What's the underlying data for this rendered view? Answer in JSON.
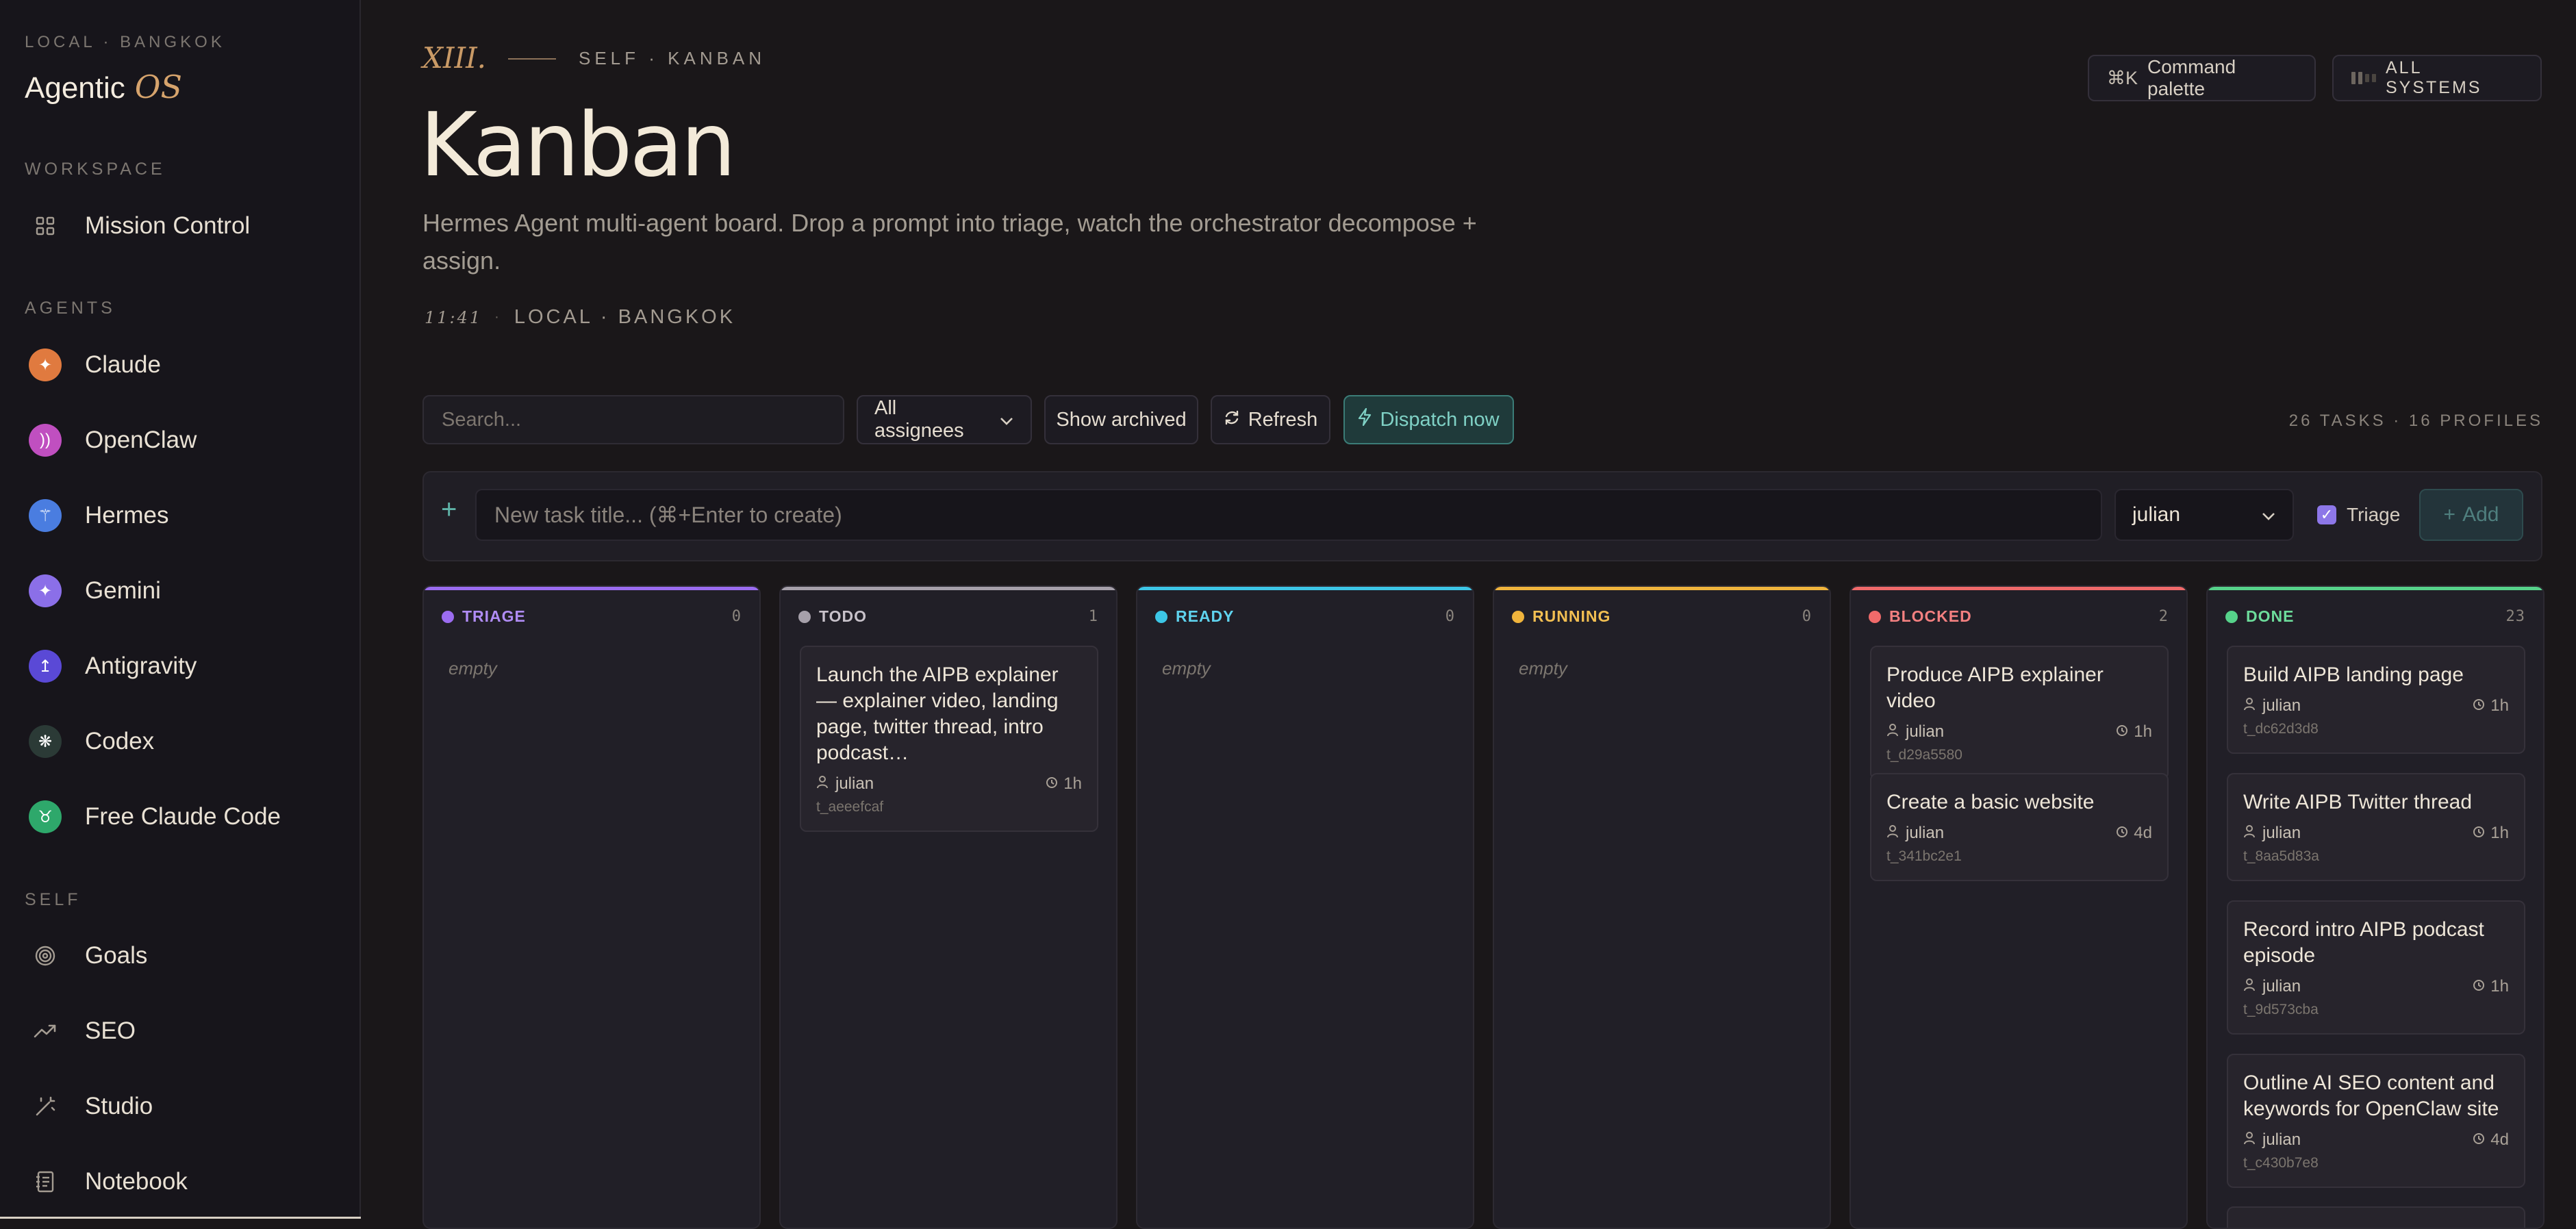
{
  "sidebar": {
    "location": "LOCAL · BANGKOK",
    "brand_name": "Agentic",
    "brand_suffix": "OS",
    "workspace_label": "WORKSPACE",
    "mission_control": "Mission Control",
    "agents_label": "AGENTS",
    "agents": [
      {
        "label": "Claude",
        "color": "#e07a3f",
        "icon": "claude-icon"
      },
      {
        "label": "OpenClaw",
        "color": "#c04fc0",
        "icon": "openclaw-icon"
      },
      {
        "label": "Hermes",
        "color": "#4a7de0",
        "icon": "hermes-icon"
      },
      {
        "label": "Gemini",
        "color": "#8b6fe8",
        "icon": "gemini-icon"
      },
      {
        "label": "Antigravity",
        "color": "#5a49d6",
        "icon": "antigravity-icon"
      },
      {
        "label": "Codex",
        "color": "#2b3a36",
        "icon": "codex-icon"
      },
      {
        "label": "Free Claude Code",
        "color": "#2ea86b",
        "icon": "free-claude-code-icon"
      }
    ],
    "self_label": "SELF",
    "self_items": [
      {
        "label": "Goals",
        "icon": "target-icon"
      },
      {
        "label": "SEO",
        "icon": "trending-up-icon"
      },
      {
        "label": "Studio",
        "icon": "magic-wand-icon"
      },
      {
        "label": "Notebook",
        "icon": "notebook-icon"
      }
    ]
  },
  "header": {
    "roman": "XIII.",
    "crumb": "SELF · KANBAN",
    "title": "Kanban",
    "description": "Hermes Agent multi-agent board. Drop a prompt into triage, watch the orchestrator decompose + assign.",
    "time": "11:41",
    "location": "LOCAL · BANGKOK",
    "command_palette_key": "⌘K",
    "command_palette_label": "Command palette",
    "systems_label": "ALL SYSTEMS"
  },
  "toolbar": {
    "search_placeholder": "Search...",
    "assignee_filter": "All assignees",
    "show_archived": "Show archived",
    "refresh": "Refresh",
    "dispatch": "Dispatch now",
    "counts": "26 TASKS · 16 PROFILES"
  },
  "new_task": {
    "placeholder": "New task title... (⌘+Enter to create)",
    "assignee": "julian",
    "triage_label": "Triage",
    "triage_checked": true,
    "add_label": "Add"
  },
  "board": {
    "empty_label": "empty",
    "columns": [
      {
        "label": "TRIAGE",
        "count": "0",
        "color": "#9b6cf0"
      },
      {
        "label": "TODO",
        "count": "1",
        "color": "#a6a0aa"
      },
      {
        "label": "READY",
        "count": "0",
        "color": "#3cc6e6"
      },
      {
        "label": "RUNNING",
        "count": "0",
        "color": "#f0b43c"
      },
      {
        "label": "BLOCKED",
        "count": "2",
        "color": "#f06a6a"
      },
      {
        "label": "DONE",
        "count": "23",
        "color": "#56d28a"
      }
    ],
    "todo_cards": [
      {
        "title": "Launch the AIPB explainer — explainer video, landing page, twitter thread, intro podcast…",
        "assignee": "julian",
        "age": "1h",
        "id": "t_aeeefcaf"
      }
    ],
    "blocked_cards": [
      {
        "title": "Produce AIPB explainer video",
        "assignee": "julian",
        "age": "1h",
        "id": "t_d29a5580"
      },
      {
        "title": "Create a basic website",
        "assignee": "julian",
        "age": "4d",
        "id": "t_341bc2e1"
      }
    ],
    "done_cards": [
      {
        "title": "Build AIPB landing page",
        "assignee": "julian",
        "age": "1h",
        "id": "t_dc62d3d8"
      },
      {
        "title": "Write AIPB Twitter thread",
        "assignee": "julian",
        "age": "1h",
        "id": "t_8aa5d83a"
      },
      {
        "title": "Record intro AIPB podcast episode",
        "assignee": "julian",
        "age": "1h",
        "id": "t_9d573cba"
      },
      {
        "title": "Outline AI SEO content and keywords for OpenClaw site",
        "assignee": "julian",
        "age": "4d",
        "id": "t_c430b7e8"
      }
    ]
  }
}
